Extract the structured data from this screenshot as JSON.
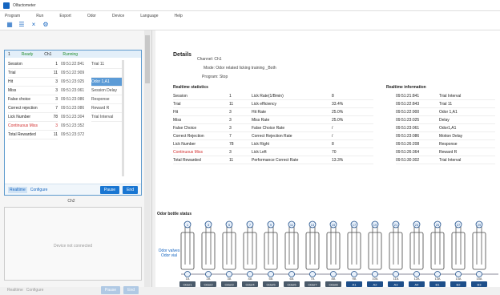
{
  "window": {
    "title": "Olfactometer"
  },
  "menu": [
    "Program",
    "Run",
    "Export",
    "Odor",
    "Device",
    "Language",
    "Help"
  ],
  "toolbar": [
    "grid-icon",
    "list-icon",
    "close-icon",
    "gear-icon"
  ],
  "card": {
    "channel": "Ch1",
    "header_left": "1",
    "status": "Ready",
    "signal": "Running",
    "stats": [
      {
        "label": "Session",
        "value": "1"
      },
      {
        "label": "Trial",
        "value": "11"
      },
      {
        "label": "Hit",
        "value": "3"
      },
      {
        "label": "Miss",
        "value": "3"
      },
      {
        "label": "False choice",
        "value": "3"
      },
      {
        "label": "Correct rejection",
        "value": "7"
      },
      {
        "label": "Lick Number",
        "value": "78"
      },
      {
        "label": "Continuous Miss",
        "value": "3",
        "red": true
      },
      {
        "label": "Total Rewarded",
        "value": "11"
      }
    ],
    "times": [
      "09:51:22:841",
      "09:51:22:909",
      "09:51:23:025",
      "09:51:23:061",
      "09:51:23:086",
      "09:51:23:086",
      "09:51:23:304",
      "09:51:23:352",
      "09:51:23:372"
    ],
    "events": [
      "Trial 11",
      "",
      "Odor 1,A1",
      "Session Delay",
      "Response",
      "Reward R",
      "Trial Interval"
    ],
    "highlighted_event": "Odor 1,A1",
    "foot_tabs": [
      "Realtime",
      "Configure"
    ],
    "pause_label": "Pause",
    "end_label": "End"
  },
  "empty": {
    "channel": "Ch2",
    "message": "Device not connected",
    "foot_tabs": [
      "Realtime",
      "Configure"
    ],
    "pause_label": "Pause",
    "end_label": "End"
  },
  "details": {
    "title": "Details",
    "channel_label": "Channel:",
    "channel_value": "Ch1",
    "mode_label": "Mode:",
    "mode_value": "Odor related licking training _Both",
    "program_label": "Program:",
    "program_value": "Stop",
    "realtime_stats_title": "Realtime statistics",
    "stats_rows": [
      [
        "Session",
        "1",
        "Lick Rate(1/Bmin)",
        "8"
      ],
      [
        "Trial",
        "11",
        "Lick efficiency",
        "33.4%"
      ],
      [
        "Hit",
        "3",
        "Hit Rate",
        "25.0%"
      ],
      [
        "Miss",
        "3",
        "Miss Rate",
        "25.0%"
      ],
      [
        "False Choice",
        "3",
        "False Choice Rate",
        "/"
      ],
      [
        "Correct Rejection",
        "7",
        "Correct Rejection Rate",
        "/"
      ],
      [
        "Lick Number",
        "78",
        "Lick Right",
        "8"
      ],
      [
        "Continuous Miss",
        "3",
        "Lick Left",
        "70"
      ],
      [
        "Total Rewarded",
        "11",
        "Performance Correct Rate",
        "13.3%"
      ]
    ],
    "realtime_info_title": "Realtime information",
    "info_rows": [
      [
        "09:51:21:841",
        "Trial Interval"
      ],
      [
        "09:51:22:843",
        "Trial 11"
      ],
      [
        "09:51:22:900",
        "Odor 1,A1"
      ],
      [
        "09:51:23:025",
        "Delay"
      ],
      [
        "09:51:23:061",
        "Odor1,A1"
      ],
      [
        "09:51:23:086",
        "Motion Delay"
      ],
      [
        "09:51:26:208",
        "Response"
      ],
      [
        "09:51:26:364",
        "Reward R"
      ],
      [
        "09:51:30:302",
        "Trial Interval"
      ]
    ],
    "odor_title": "Odor bottle status",
    "valve_label": "Odor valves Odor vial",
    "valves": [
      {
        "top": "1",
        "mid": "2",
        "bot": "1A",
        "tag": "Odor1"
      },
      {
        "top": "3",
        "mid": "4",
        "bot": "2A",
        "tag": "Odor2"
      },
      {
        "top": "5",
        "mid": "6",
        "bot": "3A",
        "tag": "Odor3"
      },
      {
        "top": "7",
        "mid": "8",
        "bot": "4A",
        "tag": "Odor4"
      },
      {
        "top": "9",
        "mid": "10",
        "bot": "5A",
        "tag": "Odor5"
      },
      {
        "top": "11",
        "mid": "12",
        "bot": "6A",
        "tag": "Odor6"
      },
      {
        "top": "13",
        "mid": "14",
        "bot": "7A",
        "tag": "Odor7"
      },
      {
        "top": "15",
        "mid": "16",
        "bot": "8A",
        "tag": "Odor8"
      },
      {
        "top": "17",
        "mid": "18",
        "bot": "9A",
        "tag": "A1"
      },
      {
        "top": "19",
        "mid": "20",
        "bot": "10A",
        "tag": "A2"
      },
      {
        "top": "21",
        "mid": "22",
        "bot": "11A",
        "tag": "A3"
      },
      {
        "top": "23",
        "mid": "24",
        "bot": "12A",
        "tag": "A4"
      },
      {
        "top": "25",
        "mid": "26",
        "bot": "13A",
        "tag": "B1"
      },
      {
        "top": "27",
        "mid": "28",
        "bot": "14A",
        "tag": "B2"
      },
      {
        "top": "29",
        "mid": "30",
        "bot": "15A",
        "tag": "B3"
      }
    ]
  },
  "colors": {
    "accent": "#1976d2",
    "running": "#1f8b2a",
    "alert": "#d32f2f",
    "bottle_dark": "#4a5a6a",
    "bottle_blue": "#1e4f8a"
  }
}
